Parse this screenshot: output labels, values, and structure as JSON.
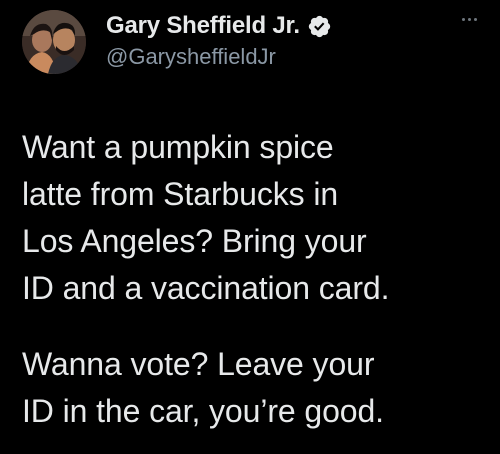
{
  "tweet": {
    "author": {
      "display_name": "Gary Sheffield Jr.",
      "handle": "@GarysheffieldJr",
      "verified": true,
      "avatar_icon": "avatar-photo-couple"
    },
    "more_icon": "more-options-icon",
    "paragraphs": [
      {
        "lines": [
          "Want a pumpkin spice",
          "latte from Starbucks in",
          "Los Angeles? Bring your",
          "ID and a vaccination card."
        ]
      },
      {
        "lines": [
          "Wanna vote? Leave your",
          "ID in the car, you’re good."
        ]
      }
    ]
  },
  "colors": {
    "background": "#000000",
    "primary_text": "#e7e9ea",
    "secondary_text": "#8b98a5",
    "verified_badge": "#e7e9ea"
  }
}
